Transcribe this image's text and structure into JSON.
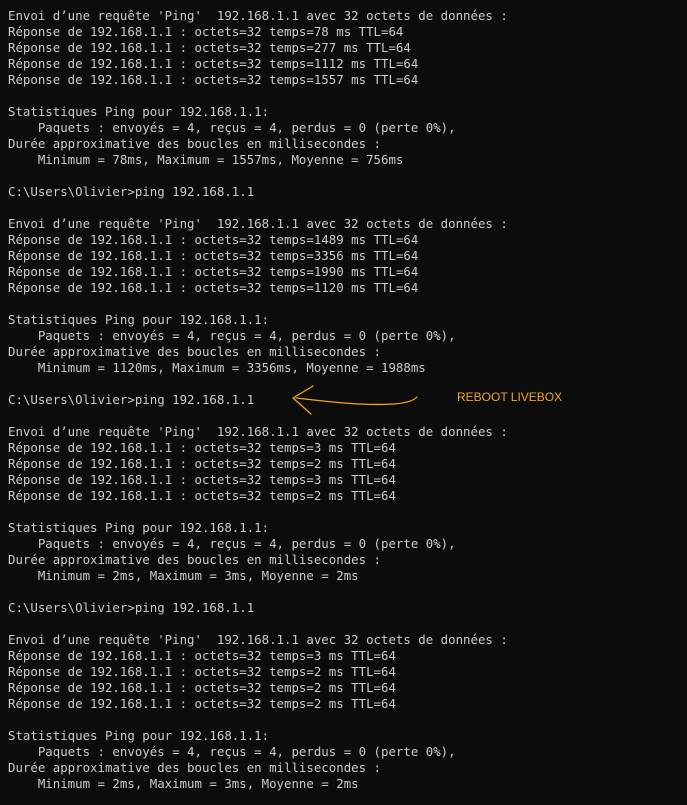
{
  "colors": {
    "background": "#0c0c0c",
    "text": "#cccccc",
    "annotation": "#f2a516"
  },
  "terminal": {
    "lines": [
      "Envoi d’une requête 'Ping'  192.168.1.1 avec 32 octets de données :",
      "Réponse de 192.168.1.1 : octets=32 temps=78 ms TTL=64",
      "Réponse de 192.168.1.1 : octets=32 temps=277 ms TTL=64",
      "Réponse de 192.168.1.1 : octets=32 temps=1112 ms TTL=64",
      "Réponse de 192.168.1.1 : octets=32 temps=1557 ms TTL=64",
      "",
      "Statistiques Ping pour 192.168.1.1:",
      "    Paquets : envoyés = 4, reçus = 4, perdus = 0 (perte 0%),",
      "Durée approximative des boucles en millisecondes :",
      "    Minimum = 78ms, Maximum = 1557ms, Moyenne = 756ms",
      "",
      "C:\\Users\\Olivier>ping 192.168.1.1",
      "",
      "Envoi d’une requête 'Ping'  192.168.1.1 avec 32 octets de données :",
      "Réponse de 192.168.1.1 : octets=32 temps=1489 ms TTL=64",
      "Réponse de 192.168.1.1 : octets=32 temps=3356 ms TTL=64",
      "Réponse de 192.168.1.1 : octets=32 temps=1990 ms TTL=64",
      "Réponse de 192.168.1.1 : octets=32 temps=1120 ms TTL=64",
      "",
      "Statistiques Ping pour 192.168.1.1:",
      "    Paquets : envoyés = 4, reçus = 4, perdus = 0 (perte 0%),",
      "Durée approximative des boucles en millisecondes :",
      "    Minimum = 1120ms, Maximum = 3356ms, Moyenne = 1988ms",
      "",
      "C:\\Users\\Olivier>ping 192.168.1.1",
      "",
      "Envoi d’une requête 'Ping'  192.168.1.1 avec 32 octets de données :",
      "Réponse de 192.168.1.1 : octets=32 temps=3 ms TTL=64",
      "Réponse de 192.168.1.1 : octets=32 temps=2 ms TTL=64",
      "Réponse de 192.168.1.1 : octets=32 temps=3 ms TTL=64",
      "Réponse de 192.168.1.1 : octets=32 temps=2 ms TTL=64",
      "",
      "Statistiques Ping pour 192.168.1.1:",
      "    Paquets : envoyés = 4, reçus = 4, perdus = 0 (perte 0%),",
      "Durée approximative des boucles en millisecondes :",
      "    Minimum = 2ms, Maximum = 3ms, Moyenne = 2ms",
      "",
      "C:\\Users\\Olivier>ping 192.168.1.1",
      "",
      "Envoi d’une requête 'Ping'  192.168.1.1 avec 32 octets de données :",
      "Réponse de 192.168.1.1 : octets=32 temps=3 ms TTL=64",
      "Réponse de 192.168.1.1 : octets=32 temps=2 ms TTL=64",
      "Réponse de 192.168.1.1 : octets=32 temps=2 ms TTL=64",
      "Réponse de 192.168.1.1 : octets=32 temps=2 ms TTL=64",
      "",
      "Statistiques Ping pour 192.168.1.1:",
      "    Paquets : envoyés = 4, reçus = 4, perdus = 0 (perte 0%),",
      "Durée approximative des boucles en millisecondes :",
      "    Minimum = 2ms, Maximum = 3ms, Moyenne = 2ms"
    ]
  },
  "annotation": {
    "label": "REBOOT LIVEBOX",
    "icon": "hand-drawn-arrow-icon"
  }
}
